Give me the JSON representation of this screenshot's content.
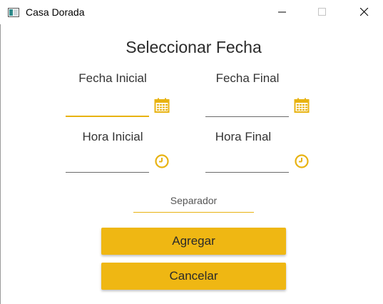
{
  "window": {
    "title": "Casa Dorada",
    "app_icon": "window-app-icon",
    "controls": [
      "minimize-icon",
      "maximize-icon",
      "close-icon"
    ]
  },
  "page": {
    "title": "Seleccionar Fecha"
  },
  "fields": {
    "fecha_inicial": {
      "label": "Fecha Inicial",
      "value": "",
      "icon": "calendar-icon"
    },
    "fecha_final": {
      "label": "Fecha Final",
      "value": "",
      "icon": "calendar-icon"
    },
    "hora_inicial": {
      "label": "Hora Inicial",
      "value": "",
      "icon": "clock-icon"
    },
    "hora_final": {
      "label": "Hora Final",
      "value": "",
      "icon": "clock-icon"
    }
  },
  "separator": {
    "placeholder": "Separador",
    "value": ""
  },
  "buttons": {
    "add": "Agregar",
    "cancel": "Cancelar"
  },
  "colors": {
    "accent": "#efb713",
    "underline": "#6b6b6b"
  }
}
